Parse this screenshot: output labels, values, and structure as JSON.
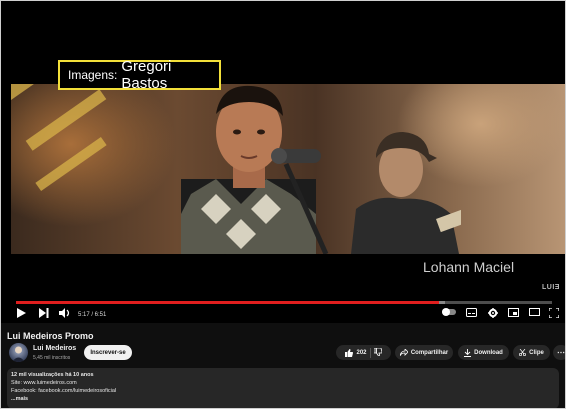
{
  "video": {
    "caption_label": "Imagens:",
    "caption_value": "Gregori Bastos",
    "lower_third_name": "Lohann Maciel",
    "watermark": "LUIƎ",
    "progress_fraction": 0.79,
    "buffered_fraction": 0.8,
    "time_display": "5:17 / 6:51"
  },
  "title": "Lui Medeiros Promo",
  "channel": {
    "name": "Lui Medeiros",
    "subscribers": "5,45 mil inscritos",
    "subscribe_label": "Inscrever-se"
  },
  "actions": {
    "likes": "202",
    "share_label": "Compartilhar",
    "download_label": "Download",
    "clip_label": "Clipe"
  },
  "description": {
    "stats": "12 mil visualizações  há 10 anos",
    "line1": "Site: www.luimedeiros.com",
    "line2": "Facebook: facebook.com/luimedeirosoficial",
    "more": "...mais"
  },
  "colors": {
    "accent": "#e01e1e",
    "caption_border": "#f3e03a",
    "background": "#0f0f0f"
  }
}
